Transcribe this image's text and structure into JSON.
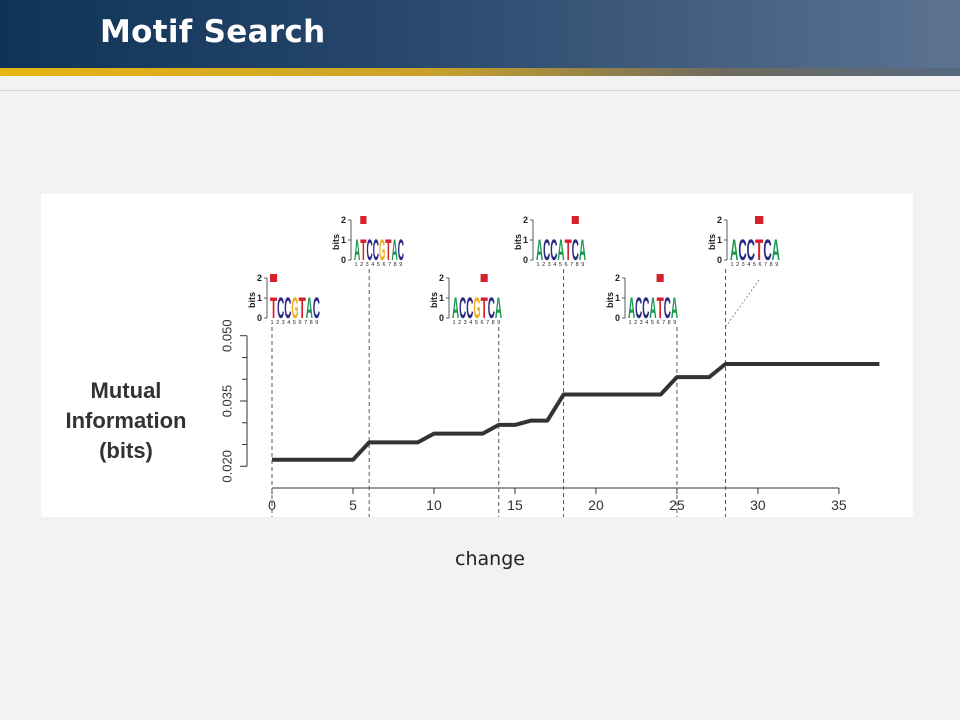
{
  "slide": {
    "title": "Motif Search",
    "caption": "change"
  },
  "colors": {
    "A": "#1a9a50",
    "C": "#2a2a86",
    "G": "#f2ad1c",
    "T": "#d6202a",
    "line": "#333333"
  },
  "chart_data": {
    "type": "line",
    "title": "",
    "xlabel": "",
    "ylabel": [
      "Mutual",
      "Information",
      "(bits)"
    ],
    "xlim": [
      0,
      38
    ],
    "ylim": [
      0.018,
      0.052
    ],
    "xticks": [
      0,
      5,
      10,
      15,
      20,
      25,
      30,
      35
    ],
    "yticks": [
      0.02,
      0.035,
      0.05
    ],
    "ytick_labels": [
      "0.020",
      "0.035",
      "0.050"
    ],
    "series": [
      {
        "x": [
          0,
          5,
          6,
          9,
          10,
          13,
          14,
          15,
          16,
          17,
          18,
          24,
          25,
          27,
          28,
          37.5
        ],
        "y": [
          0.0215,
          0.0215,
          0.0255,
          0.0255,
          0.0275,
          0.0275,
          0.0295,
          0.0295,
          0.0305,
          0.0305,
          0.0365,
          0.0365,
          0.0405,
          0.0405,
          0.0435,
          0.0435
        ]
      }
    ],
    "change_points": [
      0,
      6,
      14,
      18,
      25,
      28
    ],
    "logo_axis": {
      "label": "bits",
      "ticks": [
        "0",
        "1",
        "2"
      ],
      "positions": [
        "1",
        "2",
        "3",
        "4",
        "5",
        "6",
        "7",
        "8",
        "9"
      ]
    },
    "logos": [
      {
        "letters": "TCCGTAC",
        "marker_index": 0
      },
      {
        "letters": "ATCCGTAC",
        "marker_index": 1
      },
      {
        "letters": "ACCGTCA",
        "marker_index": 4
      },
      {
        "letters": "ACCATCA",
        "marker_index": 5
      },
      {
        "letters": "ACCATCA",
        "marker_index": 4
      },
      {
        "letters": "ACCTCA",
        "marker_index": 3
      }
    ]
  }
}
